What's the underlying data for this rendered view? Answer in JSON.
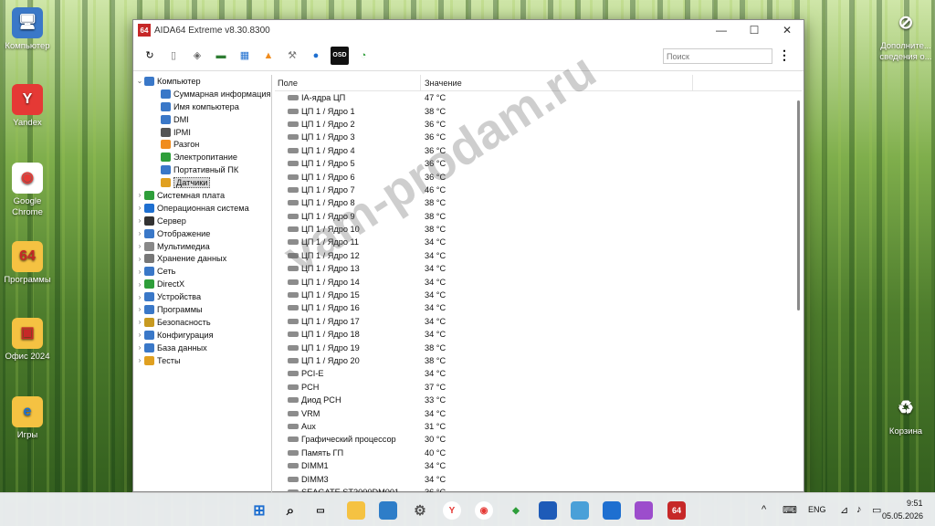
{
  "desktop": {
    "icons_left": [
      {
        "label": "Компьютер",
        "glyph": "🖥"
      },
      {
        "label": "Yandex",
        "glyph": "Y"
      },
      {
        "label": "Google Chrome",
        "glyph": "◉"
      },
      {
        "label": "Программы",
        "glyph": "64"
      },
      {
        "label": "Офис 2024",
        "glyph": "▣"
      },
      {
        "label": "Игры",
        "glyph": "e"
      }
    ],
    "icons_right": [
      {
        "label": "Дополните... сведения о...",
        "glyph": "⊘"
      },
      {
        "label": "Корзина",
        "glyph": "♻"
      }
    ]
  },
  "window": {
    "app_logo": "64",
    "title": "AIDA64 Extreme v8.30.8300",
    "search_placeholder": "Поиск",
    "menu_icon": "⋮",
    "toolbar": [
      "refresh-icon",
      "report-icon",
      "memory-icon",
      "ram-icon",
      "network-icon",
      "flame-icon",
      "tools-icon",
      "user-icon",
      "osd-icon",
      "gauge-icon"
    ],
    "osd_label": "OSD"
  },
  "tree": [
    {
      "label": "Компьютер",
      "level": 0,
      "arrow": "⌄",
      "color": "#3a78c8"
    },
    {
      "label": "Суммарная информация",
      "level": 1,
      "arrow": "",
      "color": "#3a78c8"
    },
    {
      "label": "Имя компьютера",
      "level": 1,
      "arrow": "",
      "color": "#3a78c8"
    },
    {
      "label": "DMI",
      "level": 1,
      "arrow": "",
      "color": "#3a78c8"
    },
    {
      "label": "IPMI",
      "level": 1,
      "arrow": "",
      "color": "#555555"
    },
    {
      "label": "Разгон",
      "level": 1,
      "arrow": "",
      "color": "#f08c1e"
    },
    {
      "label": "Электропитание",
      "level": 1,
      "arrow": "",
      "color": "#2e9e3a"
    },
    {
      "label": "Портативный ПК",
      "level": 1,
      "arrow": "",
      "color": "#3a78c8"
    },
    {
      "label": "Датчики",
      "level": 1,
      "arrow": "",
      "color": "#e0a020",
      "selected": true
    },
    {
      "label": "Системная плата",
      "level": 0,
      "arrow": "›",
      "color": "#2e9e3a"
    },
    {
      "label": "Операционная система",
      "level": 0,
      "arrow": "›",
      "color": "#1e6fd0"
    },
    {
      "label": "Сервер",
      "level": 0,
      "arrow": "›",
      "color": "#333333"
    },
    {
      "label": "Отображение",
      "level": 0,
      "arrow": "›",
      "color": "#3a78c8"
    },
    {
      "label": "Мультимедиа",
      "level": 0,
      "arrow": "›",
      "color": "#888888"
    },
    {
      "label": "Хранение данных",
      "level": 0,
      "arrow": "›",
      "color": "#777777"
    },
    {
      "label": "Сеть",
      "level": 0,
      "arrow": "›",
      "color": "#3a78c8"
    },
    {
      "label": "DirectX",
      "level": 0,
      "arrow": "›",
      "color": "#2e9e3a"
    },
    {
      "label": "Устройства",
      "level": 0,
      "arrow": "›",
      "color": "#3a78c8"
    },
    {
      "label": "Программы",
      "level": 0,
      "arrow": "›",
      "color": "#3a78c8"
    },
    {
      "label": "Безопасность",
      "level": 0,
      "arrow": "›",
      "color": "#c89a20"
    },
    {
      "label": "Конфигурация",
      "level": 0,
      "arrow": "›",
      "color": "#3a78c8"
    },
    {
      "label": "База данных",
      "level": 0,
      "arrow": "›",
      "color": "#3a78c8"
    },
    {
      "label": "Тесты",
      "level": 0,
      "arrow": "›",
      "color": "#e0a020"
    }
  ],
  "list": {
    "col_field": "Поле",
    "col_value": "Значение",
    "rows": [
      {
        "field": "IA-ядра ЦП",
        "value": "47 °C"
      },
      {
        "field": "ЦП 1 / Ядро 1",
        "value": "38 °C"
      },
      {
        "field": "ЦП 1 / Ядро 2",
        "value": "36 °C"
      },
      {
        "field": "ЦП 1 / Ядро 3",
        "value": "36 °C"
      },
      {
        "field": "ЦП 1 / Ядро 4",
        "value": "36 °C"
      },
      {
        "field": "ЦП 1 / Ядро 5",
        "value": "36 °C"
      },
      {
        "field": "ЦП 1 / Ядро 6",
        "value": "36 °C"
      },
      {
        "field": "ЦП 1 / Ядро 7",
        "value": "46 °C"
      },
      {
        "field": "ЦП 1 / Ядро 8",
        "value": "38 °C"
      },
      {
        "field": "ЦП 1 / Ядро 9",
        "value": "38 °C"
      },
      {
        "field": "ЦП 1 / Ядро 10",
        "value": "38 °C"
      },
      {
        "field": "ЦП 1 / Ядро 11",
        "value": "34 °C"
      },
      {
        "field": "ЦП 1 / Ядро 12",
        "value": "34 °C"
      },
      {
        "field": "ЦП 1 / Ядро 13",
        "value": "34 °C"
      },
      {
        "field": "ЦП 1 / Ядро 14",
        "value": "34 °C"
      },
      {
        "field": "ЦП 1 / Ядро 15",
        "value": "34 °C"
      },
      {
        "field": "ЦП 1 / Ядро 16",
        "value": "34 °C"
      },
      {
        "field": "ЦП 1 / Ядро 17",
        "value": "34 °C"
      },
      {
        "field": "ЦП 1 / Ядро 18",
        "value": "34 °C"
      },
      {
        "field": "ЦП 1 / Ядро 19",
        "value": "38 °C"
      },
      {
        "field": "ЦП 1 / Ядро 20",
        "value": "38 °C"
      },
      {
        "field": "PCI-E",
        "value": "34 °C"
      },
      {
        "field": "PCH",
        "value": "37 °C"
      },
      {
        "field": "Диод PCH",
        "value": "33 °C"
      },
      {
        "field": "VRM",
        "value": "34 °C"
      },
      {
        "field": "Aux",
        "value": "31 °C"
      },
      {
        "field": "Графический процессор",
        "value": "30 °C"
      },
      {
        "field": "Память ГП",
        "value": "40 °C"
      },
      {
        "field": "DIMM1",
        "value": "34 °C"
      },
      {
        "field": "DIMM3",
        "value": "34 °C"
      },
      {
        "field": "SEAGATE ST2000DM001",
        "value": "36 °C"
      }
    ]
  },
  "watermark": "vam-prodam.ru",
  "taskbar": {
    "language": "ENG",
    "time": "9:51",
    "date": "05.05.2026",
    "chevron": "^"
  }
}
